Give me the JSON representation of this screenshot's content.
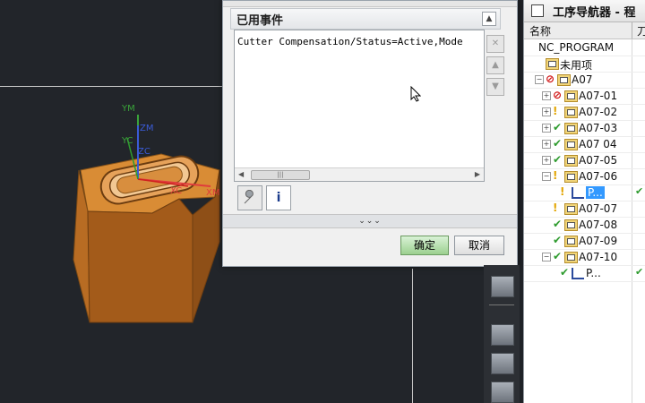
{
  "dialog": {
    "section_title": "已用事件",
    "events_text": "Cutter Compensation/Status=Active,Mode",
    "scroll_thumb": "|||",
    "info_label": "i",
    "expander": "⌄⌄⌄",
    "ok_label": "确定",
    "cancel_label": "取消"
  },
  "viewport": {
    "axis_labels": {
      "ym": "YM",
      "zm": "ZM",
      "yc": "YC",
      "zc": "ZC",
      "xc": "XC",
      "xm": "XM"
    }
  },
  "navigator": {
    "title": "工序导航器 - 程",
    "col_name": "名称",
    "col_2": "刀",
    "rows": [
      {
        "label": "NC_PROGRAM",
        "level": 0,
        "expand": "",
        "status": "",
        "icon": "",
        "col2": ""
      },
      {
        "label": "未用项",
        "level": 1,
        "expand": "",
        "status": "",
        "icon": "folder",
        "col2": ""
      },
      {
        "label": "A07",
        "level": 1,
        "expand": "−",
        "status": "forbidden",
        "icon": "folder",
        "col2": ""
      },
      {
        "label": "A07-01",
        "level": 2,
        "expand": "+",
        "status": "forbidden",
        "icon": "folder",
        "col2": ""
      },
      {
        "label": "A07-02",
        "level": 2,
        "expand": "+",
        "status": "warn",
        "icon": "folder",
        "col2": ""
      },
      {
        "label": "A07-03",
        "level": 2,
        "expand": "+",
        "status": "ok",
        "icon": "folder",
        "col2": ""
      },
      {
        "label": "A07 04",
        "level": 2,
        "expand": "+",
        "status": "ok",
        "icon": "folder",
        "col2": ""
      },
      {
        "label": "A07-05",
        "level": 2,
        "expand": "+",
        "status": "ok",
        "icon": "folder",
        "col2": ""
      },
      {
        "label": "A07-06",
        "level": 2,
        "expand": "−",
        "status": "warn",
        "icon": "folder",
        "col2": ""
      },
      {
        "label": "P...",
        "level": 3,
        "expand": "",
        "status": "warn",
        "icon": "op",
        "col2": "✔",
        "selected": true
      },
      {
        "label": "A07-07",
        "level": 2,
        "expand": "",
        "status": "warn",
        "icon": "folder",
        "col2": ""
      },
      {
        "label": "A07-08",
        "level": 2,
        "expand": "",
        "status": "ok",
        "icon": "folder",
        "col2": ""
      },
      {
        "label": "A07-09",
        "level": 2,
        "expand": "",
        "status": "ok",
        "icon": "folder",
        "col2": ""
      },
      {
        "label": "A07-10",
        "level": 2,
        "expand": "−",
        "status": "ok",
        "icon": "folder",
        "col2": ""
      },
      {
        "label": "P...",
        "level": 3,
        "expand": "",
        "status": "ok",
        "icon": "op",
        "col2": "✔"
      }
    ]
  },
  "colors": {
    "ok": "#2e9b2e",
    "warn": "#e2a400",
    "forbidden": "#d01010",
    "selection": "#3399ff",
    "part": "#c97a2c"
  }
}
